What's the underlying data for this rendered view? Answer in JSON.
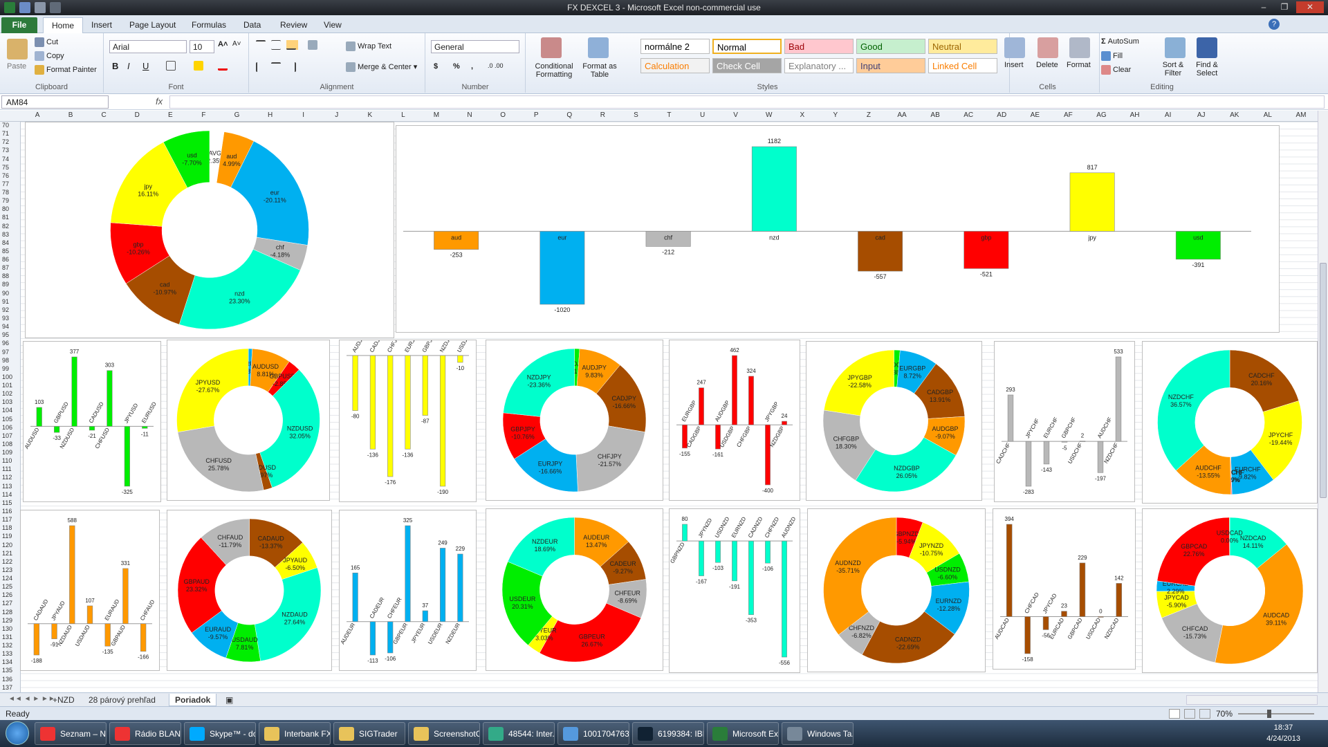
{
  "window": {
    "title": "FX DEXCEL 3  -  Microsoft Excel non-commercial use"
  },
  "ribbon_tabs": [
    "File",
    "Home",
    "Insert",
    "Page Layout",
    "Formulas",
    "Data",
    "Review",
    "View"
  ],
  "clipboard": {
    "paste": "Paste",
    "cut": "Cut",
    "copy": "Copy",
    "painter": "Format Painter",
    "label": "Clipboard"
  },
  "font": {
    "name": "Arial",
    "size": "10",
    "label": "Font",
    "bold": "B",
    "italic": "I",
    "underline": "U"
  },
  "alignment": {
    "wrap": "Wrap Text",
    "merge": "Merge & Center",
    "label": "Alignment"
  },
  "number": {
    "format": "General",
    "label": "Number",
    "currency": "$",
    "percent": "%",
    "comma": ","
  },
  "styles": {
    "conditional": "Conditional Formatting",
    "format_table": "Format as Table",
    "label": "Styles",
    "cells": [
      {
        "name": "normálne 2",
        "bg": "#ffffff",
        "fg": "#000000"
      },
      {
        "name": "Normal",
        "bg": "#ffffff",
        "fg": "#000000"
      },
      {
        "name": "Bad",
        "bg": "#ffc7ce",
        "fg": "#9c0006"
      },
      {
        "name": "Good",
        "bg": "#c6efce",
        "fg": "#006100"
      },
      {
        "name": "Neutral",
        "bg": "#ffeb9c",
        "fg": "#9c6500"
      },
      {
        "name": "Calculation",
        "bg": "#f2f2f2",
        "fg": "#fa7d00"
      },
      {
        "name": "Check Cell",
        "bg": "#a5a5a5",
        "fg": "#ffffff"
      },
      {
        "name": "Explanatory ...",
        "bg": "#ffffff",
        "fg": "#7f7f7f"
      },
      {
        "name": "Input",
        "bg": "#ffcc99",
        "fg": "#3f3f76"
      },
      {
        "name": "Linked Cell",
        "bg": "#ffffff",
        "fg": "#fa7d00"
      }
    ]
  },
  "cells_group": {
    "insert": "Insert",
    "delete": "Delete",
    "format": "Format",
    "label": "Cells"
  },
  "editing": {
    "autosum": "AutoSum",
    "fill": "Fill",
    "clear": "Clear",
    "sort": "Sort & Filter",
    "find": "Find & Select",
    "label": "Editing"
  },
  "formula_bar": {
    "name_box": "AM84",
    "fx": "fx",
    "formula": ""
  },
  "columns": [
    "A",
    "B",
    "C",
    "D",
    "E",
    "F",
    "G",
    "H",
    "I",
    "J",
    "K",
    "L",
    "M",
    "N",
    "O",
    "P",
    "Q",
    "R",
    "S",
    "T",
    "U",
    "V",
    "W",
    "X",
    "Y",
    "Z",
    "AA",
    "AB",
    "AC",
    "AD",
    "AE",
    "AF",
    "AG",
    "AH",
    "AI",
    "AJ",
    "AK",
    "AL",
    "AM"
  ],
  "rows_start": 70,
  "rows_end": 138,
  "colors": {
    "aud": "#ff9900",
    "eur": "#00b0f0",
    "chf": "#b8b8b8",
    "nzd": "#00ffcc",
    "cad": "#a64d00",
    "gbp": "#ff0000",
    "jpy": "#ffff00",
    "usd": "#00ee00",
    "avg": "#ffffff"
  },
  "chart_data": [
    {
      "type": "pie",
      "id": "main-donut",
      "slices": [
        {
          "label": "AVG",
          "pct": "-2.35%",
          "value": 2.35,
          "c": "avg"
        },
        {
          "label": "aud",
          "pct": "4.99%",
          "value": 4.99,
          "c": "aud"
        },
        {
          "label": "eur",
          "pct": "-20.11%",
          "value": 20.11,
          "c": "eur"
        },
        {
          "label": "chf",
          "pct": "-4.18%",
          "value": 4.18,
          "c": "chf"
        },
        {
          "label": "nzd",
          "pct": "23.30%",
          "value": 23.3,
          "c": "nzd"
        },
        {
          "label": "cad",
          "pct": "-10.97%",
          "value": 10.97,
          "c": "cad"
        },
        {
          "label": "gbp",
          "pct": "-10.26%",
          "value": 10.26,
          "c": "gbp"
        },
        {
          "label": "jpy",
          "pct": "16.11%",
          "value": 16.11,
          "c": "jpy"
        },
        {
          "label": "usd",
          "pct": "-7.70%",
          "value": 7.7,
          "c": "usd"
        }
      ]
    },
    {
      "type": "bar",
      "id": "main-bar",
      "categories": [
        "aud",
        "eur",
        "chf",
        "nzd",
        "cad",
        "gbp",
        "jpy",
        "usd"
      ],
      "values": [
        -253,
        -1020,
        -212,
        1182,
        -557,
        -521,
        817,
        -391
      ],
      "colors": [
        "aud",
        "eur",
        "chf",
        "nzd",
        "cad",
        "gbp",
        "jpy",
        "usd"
      ]
    },
    {
      "type": "bar",
      "id": "usd-bar",
      "categories": [
        "AUDUSD",
        "GBPUSD",
        "NZDUSD",
        "CADUSD",
        "CHFUSD",
        "JPYUSD",
        "EURUSD"
      ],
      "values": [
        103,
        -33,
        377,
        -21,
        303,
        -325,
        -11
      ],
      "color": "usd"
    },
    {
      "type": "pie",
      "id": "usd-donut",
      "slices": [
        {
          "label": "EURUSD",
          "pct": "-0.89%",
          "value": 0.89,
          "c": "eur"
        },
        {
          "label": "AUDUSD",
          "pct": "8.81%",
          "value": 8.81,
          "c": "aud"
        },
        {
          "label": "GBPUSD",
          "pct": "-2.85%",
          "value": 2.85,
          "c": "gbp"
        },
        {
          "label": "NZDUSD",
          "pct": "32.05%",
          "value": 32.05,
          "c": "nzd"
        },
        {
          "label": "CADUSD",
          "pct": "-1.97%",
          "value": 1.97,
          "c": "cad"
        },
        {
          "label": "CHFUSD",
          "pct": "25.78%",
          "value": 25.78,
          "c": "chf"
        },
        {
          "label": "JPYUSD",
          "pct": "-27.67%",
          "value": 27.67,
          "c": "jpy"
        }
      ]
    },
    {
      "type": "bar",
      "id": "jpy-bar",
      "categories": [
        "AUDJPY",
        "CADJPY",
        "CHFJPY",
        "EURJPY",
        "GBPJPY",
        "NZDJPY",
        "USDJPY"
      ],
      "values": [
        -80,
        -136,
        -176,
        -136,
        -87,
        -190,
        -10
      ],
      "color": "jpy"
    },
    {
      "type": "pie",
      "id": "jpy-donut",
      "slices": [
        {
          "label": "USDJPY",
          "pct": "-1.17%",
          "value": 1.17,
          "c": "usd"
        },
        {
          "label": "AUDJPY",
          "pct": "9.83%",
          "value": 9.83,
          "c": "aud"
        },
        {
          "label": "CADJPY",
          "pct": "-16.66%",
          "value": 16.66,
          "c": "cad"
        },
        {
          "label": "CHFJPY",
          "pct": "-21.57%",
          "value": 21.57,
          "c": "chf"
        },
        {
          "label": "EURJPY",
          "pct": "-16.66%",
          "value": 16.66,
          "c": "eur"
        },
        {
          "label": "GBPJPY",
          "pct": "-10.76%",
          "value": 10.76,
          "c": "gbp"
        },
        {
          "label": "NZDJPY",
          "pct": "-23.36%",
          "value": 23.36,
          "c": "nzd"
        }
      ]
    },
    {
      "type": "bar",
      "id": "gbp-bar",
      "categories": [
        "EURGBP",
        "CADGBP",
        "AUDGBP",
        "USDGBP",
        "CHFGBP",
        "JPYGBP",
        "NZDGBP"
      ],
      "values": [
        -155,
        247,
        -161,
        462,
        324,
        -400,
        24
      ],
      "color": "gbp"
    },
    {
      "type": "pie",
      "id": "gbp-donut",
      "slices": [
        {
          "label": "USDGBP",
          "pct": "1.38%",
          "value": 1.38,
          "c": "usd"
        },
        {
          "label": "EURGBP",
          "pct": "8.72%",
          "value": 8.72,
          "c": "eur"
        },
        {
          "label": "CADGBP",
          "pct": "13.91%",
          "value": 13.91,
          "c": "cad"
        },
        {
          "label": "AUDGBP",
          "pct": "-9.07%",
          "value": 9.07,
          "c": "aud"
        },
        {
          "label": "NZDGBP",
          "pct": "26.05%",
          "value": 26.05,
          "c": "nzd"
        },
        {
          "label": "CHFGBP",
          "pct": "18.30%",
          "value": 18.3,
          "c": "chf"
        },
        {
          "label": "JPYGBP",
          "pct": "-22.58%",
          "value": 22.58,
          "c": "jpy"
        }
      ]
    },
    {
      "type": "bar",
      "id": "chf-bar",
      "categories": [
        "CADCHF",
        "JPYCHF",
        "EURCHF",
        "GBPCHF",
        "USDCHF",
        "AUDCHF",
        "NZDCHF"
      ],
      "values": [
        293,
        -283,
        -143,
        -5,
        2,
        -197,
        533
      ],
      "color": "chf"
    },
    {
      "type": "pie",
      "id": "chf-donut",
      "slices": [
        {
          "label": "CADCHF",
          "pct": "20.16%",
          "value": 20.16,
          "c": "cad"
        },
        {
          "label": "JPYCHF",
          "pct": "-19.44%",
          "value": 19.44,
          "c": "jpy"
        },
        {
          "label": "EURCHF",
          "pct": "9.82%",
          "value": 9.82,
          "c": "eur"
        },
        {
          "label": "USDCHF",
          "pct": "0.07%",
          "value": 0.07,
          "c": "usd"
        },
        {
          "label": "GBPCHF",
          "pct": "0.19%",
          "value": 0.19,
          "c": "gbp"
        },
        {
          "label": "AUDCHF",
          "pct": "-13.55%",
          "value": 13.55,
          "c": "aud"
        },
        {
          "label": "NZDCHF",
          "pct": "36.57%",
          "value": 36.57,
          "c": "nzd"
        }
      ]
    },
    {
      "type": "bar",
      "id": "aud-bar",
      "categories": [
        "CADAUD",
        "JPYAUD",
        "NZDAUD",
        "USDAUD",
        "EURAUD",
        "GBPAUD",
        "CHFAUD"
      ],
      "values": [
        -188,
        -91,
        588,
        107,
        -135,
        331,
        -166
      ],
      "color": "aud"
    },
    {
      "type": "pie",
      "id": "aud-donut",
      "slices": [
        {
          "label": "CADAUD",
          "pct": "-13.37%",
          "value": 13.37,
          "c": "cad"
        },
        {
          "label": "JPYAUD",
          "pct": "-6.50%",
          "value": 6.5,
          "c": "jpy"
        },
        {
          "label": "NZDAUD",
          "pct": "27.64%",
          "value": 27.64,
          "c": "nzd"
        },
        {
          "label": "USDAUD",
          "pct": "7.81%",
          "value": 7.81,
          "c": "usd"
        },
        {
          "label": "EURAUD",
          "pct": "-9.57%",
          "value": 9.57,
          "c": "eur"
        },
        {
          "label": "GBPAUD",
          "pct": "23.32%",
          "value": 23.32,
          "c": "gbp"
        },
        {
          "label": "CHFAUD",
          "pct": "-11.79%",
          "value": 11.79,
          "c": "chf"
        }
      ]
    },
    {
      "type": "bar",
      "id": "eur-bar",
      "categories": [
        "AUDEUR",
        "CADEUR",
        "CHFEUR",
        "GBPEUR",
        "JPYEUR",
        "USDEUR",
        "NZDEUR"
      ],
      "values": [
        165,
        -113,
        -106,
        325,
        37,
        249,
        229
      ],
      "color": "eur"
    },
    {
      "type": "pie",
      "id": "eur-donut",
      "slices": [
        {
          "label": "AUDEUR",
          "pct": "13.47%",
          "value": 13.47,
          "c": "aud"
        },
        {
          "label": "CADEUR",
          "pct": "-9.27%",
          "value": 9.27,
          "c": "cad"
        },
        {
          "label": "CHFEUR",
          "pct": "-8.69%",
          "value": 8.69,
          "c": "chf"
        },
        {
          "label": "GBPEUR",
          "pct": "26.67%",
          "value": 26.67,
          "c": "gbp"
        },
        {
          "label": "JPYEUR",
          "pct": "3.03%",
          "value": 3.03,
          "c": "jpy"
        },
        {
          "label": "USDEUR",
          "pct": "20.31%",
          "value": 20.31,
          "c": "usd"
        },
        {
          "label": "NZDEUR",
          "pct": "18.69%",
          "value": 18.69,
          "c": "nzd"
        }
      ]
    },
    {
      "type": "bar",
      "id": "nzd-bar",
      "categories": [
        "GBPNZD",
        "JPYNZD",
        "USDNZD",
        "EURNZD",
        "CADNZD",
        "CHFNZD",
        "AUDNZD"
      ],
      "values": [
        80,
        -167,
        -103,
        -191,
        -353,
        -106,
        -556
      ],
      "color": "nzd"
    },
    {
      "type": "pie",
      "id": "nzd-donut",
      "slices": [
        {
          "label": "GBPNZD",
          "pct": "-5.94%",
          "value": 5.94,
          "c": "gbp"
        },
        {
          "label": "JPYNZD",
          "pct": "-10.75%",
          "value": 10.75,
          "c": "jpy"
        },
        {
          "label": "USDNZD",
          "pct": "-6.60%",
          "value": 6.6,
          "c": "usd"
        },
        {
          "label": "EURNZD",
          "pct": "-12.28%",
          "value": 12.28,
          "c": "eur"
        },
        {
          "label": "CADNZD",
          "pct": "-22.69%",
          "value": 22.69,
          "c": "cad"
        },
        {
          "label": "CHFNZD",
          "pct": "-6.82%",
          "value": 6.82,
          "c": "chf"
        },
        {
          "label": "AUDNZD",
          "pct": "-35.71%",
          "value": 35.71,
          "c": "aud"
        }
      ]
    },
    {
      "type": "bar",
      "id": "cad-bar",
      "categories": [
        "AUDCAD",
        "CHFCAD",
        "JPYCAD",
        "EURCAD",
        "GBPCAD",
        "USDCAD",
        "NZDCAD"
      ],
      "values": [
        394,
        -158,
        -56,
        23,
        229,
        0,
        142
      ],
      "color": "cad"
    },
    {
      "type": "pie",
      "id": "cad-donut",
      "slices": [
        {
          "label": "NZDCAD",
          "pct": "14.11%",
          "value": 14.11,
          "c": "nzd"
        },
        {
          "label": "AUDCAD",
          "pct": "39.11%",
          "value": 39.11,
          "c": "aud"
        },
        {
          "label": "CHFCAD",
          "pct": "-15.73%",
          "value": 15.73,
          "c": "chf"
        },
        {
          "label": "JPYCAD",
          "pct": "-5.90%",
          "value": 5.9,
          "c": "jpy"
        },
        {
          "label": "EURCAD",
          "pct": "2.29%",
          "value": 2.29,
          "c": "eur"
        },
        {
          "label": "GBPCAD",
          "pct": "22.76%",
          "value": 22.76,
          "c": "gbp"
        },
        {
          "label": "USDCAD",
          "pct": "0.00%",
          "value": 0.1,
          "c": "usd"
        }
      ]
    }
  ],
  "sheet_tabs": [
    "+NZD",
    "28 párový prehľad",
    "Poriadok"
  ],
  "active_sheet": "Poriadok",
  "status": {
    "ready": "Ready",
    "zoom": "70%"
  },
  "taskbar": {
    "items": [
      {
        "label": "Seznam – N...",
        "c": "#e33"
      },
      {
        "label": "Rádio BLANÍ...",
        "c": "#e33"
      },
      {
        "label": "Skype™ - do...",
        "c": "#0af"
      },
      {
        "label": "Interbank FX...",
        "c": "#e8c35a"
      },
      {
        "label": "SIGTrader",
        "c": "#e8c35a"
      },
      {
        "label": "ScreenshotC...",
        "c": "#e8c35a"
      },
      {
        "label": "48544: Inter...",
        "c": "#3a8"
      },
      {
        "label": "1001704763: ...",
        "c": "#59d"
      },
      {
        "label": "6199384: IBF...",
        "c": "#123"
      },
      {
        "label": "Microsoft Ex...",
        "c": "#2a7d3a"
      },
      {
        "label": "Windows Ta...",
        "c": "#789"
      }
    ],
    "time": "18:37",
    "date": "4/24/2013"
  }
}
